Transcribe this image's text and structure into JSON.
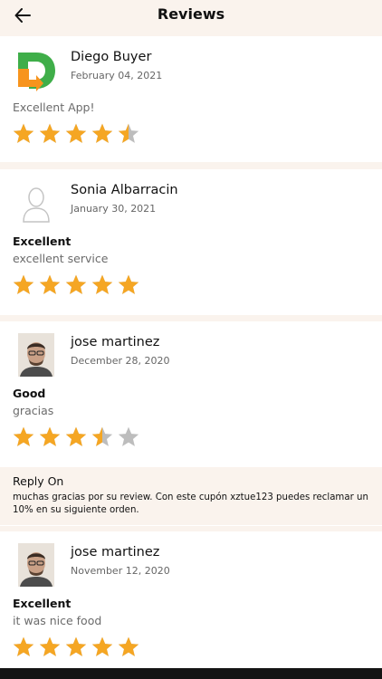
{
  "header": {
    "title": "Reviews",
    "back_icon": "arrow-left-icon"
  },
  "reviews": [
    {
      "name": "Diego Buyer",
      "date": "February 04, 2021",
      "title": "",
      "text": "Excellent App!",
      "rating": 4.5,
      "avatar": "app-logo"
    },
    {
      "name": "Sonia Albarracin",
      "date": "January 30, 2021",
      "title": "Excellent",
      "text": "excellent service",
      "rating": 5,
      "avatar": "placeholder-user-icon"
    },
    {
      "name": "jose martinez",
      "date": "December 28, 2020",
      "title": "Good",
      "text": "gracias",
      "rating": 3.5,
      "avatar": "user-photo",
      "reply": {
        "title": "Reply On",
        "text": "muchas gracias por su review. Con este cupón xztue123 puedes reclamar un 10% en su siguiente orden."
      }
    },
    {
      "name": "jose martinez",
      "date": "November 12, 2020",
      "title": "Excellent",
      "text": "it was nice food",
      "rating": 5,
      "avatar": "user-photo"
    }
  ],
  "colors": {
    "star_filled": "#f5a623",
    "star_empty": "#bdbdbd",
    "background": "#faf3ed",
    "card": "#ffffff"
  }
}
